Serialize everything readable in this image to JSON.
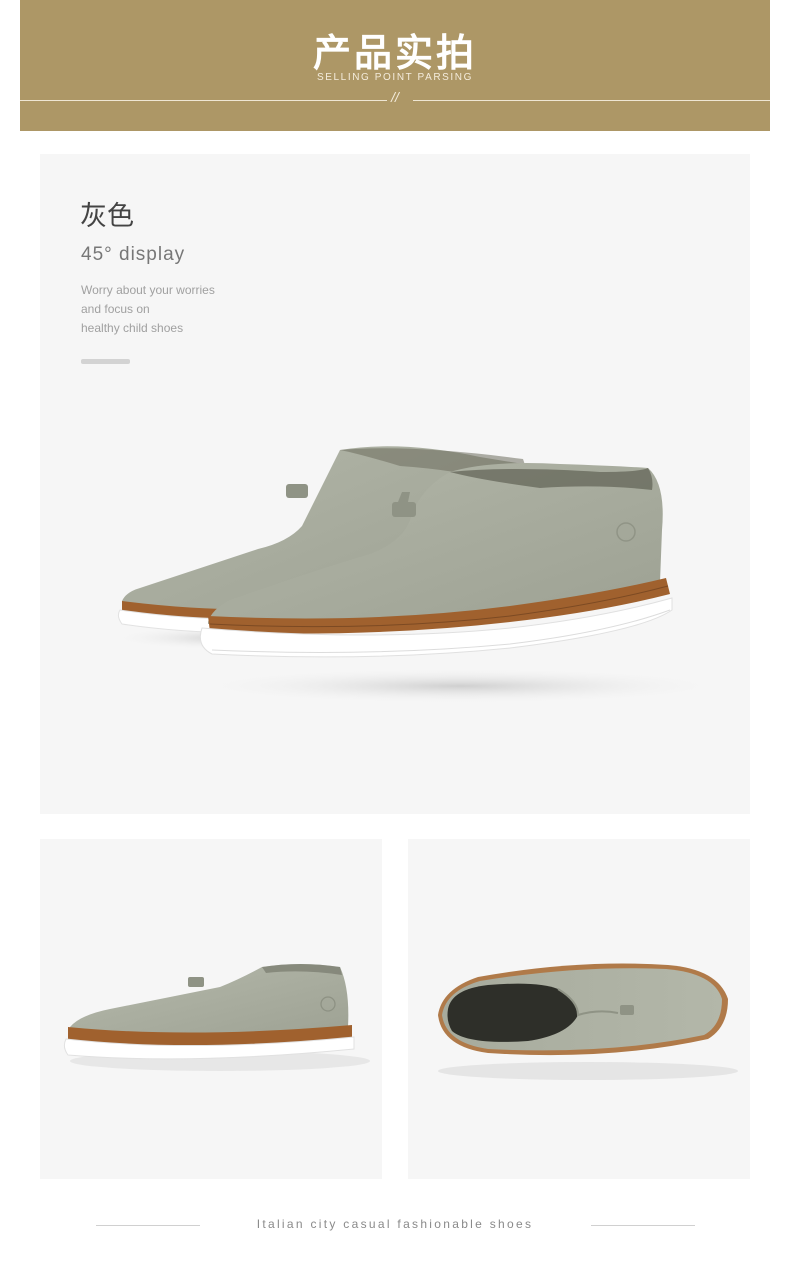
{
  "banner": {
    "title": "产品实拍",
    "subtitle": "SELLING POINT PARSING",
    "mark": "//",
    "color": "#ad9766"
  },
  "hero": {
    "color_name": "灰色",
    "display_label": "45° display",
    "description": [
      "Worry about your worries",
      "and focus on",
      "healthy child shoes"
    ],
    "image": "gray-slip-on-shoes-pair-45-degree"
  },
  "gallery": [
    {
      "image": "gray-slip-on-shoe-side-view"
    },
    {
      "image": "gray-slip-on-shoe-top-view"
    }
  ],
  "footer": {
    "tagline": "Italian city casual fashionable shoes"
  },
  "colors": {
    "upper": "#a9ad9f",
    "welt": "#a0612e",
    "sole": "#ffffff",
    "panel_bg": "#f6f6f6"
  }
}
